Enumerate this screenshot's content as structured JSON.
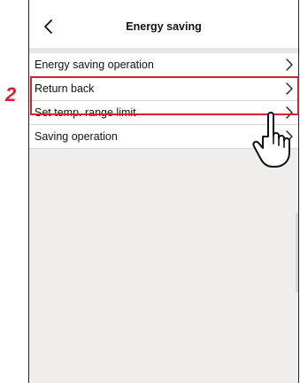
{
  "header": {
    "title": "Energy saving",
    "back_icon": "chevron-left-icon"
  },
  "menu": {
    "items": [
      {
        "label": "Energy saving operation"
      },
      {
        "label": "Return back"
      },
      {
        "label": "Set temp. range limit"
      },
      {
        "label": "Saving operation"
      }
    ]
  },
  "annotation": {
    "step_number": "2",
    "color": "#d8202a",
    "pointer_icon": "hand-pointer-icon"
  },
  "colors": {
    "background": "#efeeec",
    "surface": "#ffffff",
    "accent": "#d8202a"
  }
}
